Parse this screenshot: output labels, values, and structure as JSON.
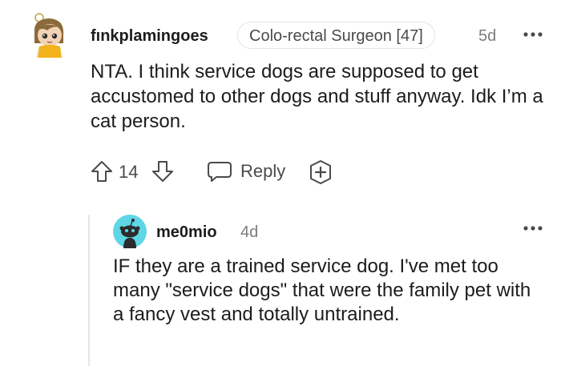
{
  "comment": {
    "username": "fınkplamingoes",
    "flair": "Colo-rectal Surgeon [47]",
    "time": "5d",
    "body": "NTA. I think service dogs are supposed to get accustomed to other dogs and stuff anyway. Idk I’m a cat person.",
    "score": "14",
    "reply_label": "Reply",
    "avatar_icon": "avatar-girl-icon"
  },
  "reply": {
    "username": "me0mio",
    "time": "4d",
    "body": "IF they are a trained service dog. I've met too many \"service dogs\" that were the family pet with a fancy vest and totally untrained.",
    "avatar_icon": "snoo-avatar-icon"
  },
  "colors": {
    "text": "#1c1c1c",
    "meta": "#7c7c7c",
    "action": "#4a4a4a",
    "snoo_bg": "#5fd6e6",
    "thread_line": "#e5e5e5"
  }
}
